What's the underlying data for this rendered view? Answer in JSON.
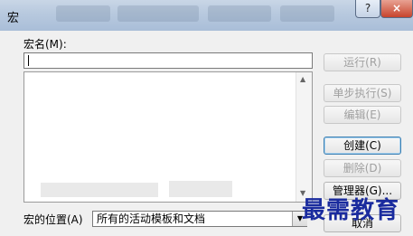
{
  "window": {
    "title": "宏",
    "help_label": "?",
    "close_label": "×"
  },
  "macro_name": {
    "label": "宏名(M):",
    "value": ""
  },
  "buttons": {
    "run": "运行(R)",
    "step_into": "单步执行(S)",
    "edit": "编辑(E)",
    "create": "创建(C)",
    "delete": "删除(D)",
    "organizer": "管理器(G)...",
    "cancel": "取消"
  },
  "macros_in": {
    "label": "宏的位置(A)",
    "selected": "所有的活动模板和文档"
  },
  "watermark": "最需教育",
  "colors": {
    "watermark": "#1a2b9e",
    "dialog_bg": "#f0f0f0",
    "close_button": "#c7442c"
  }
}
